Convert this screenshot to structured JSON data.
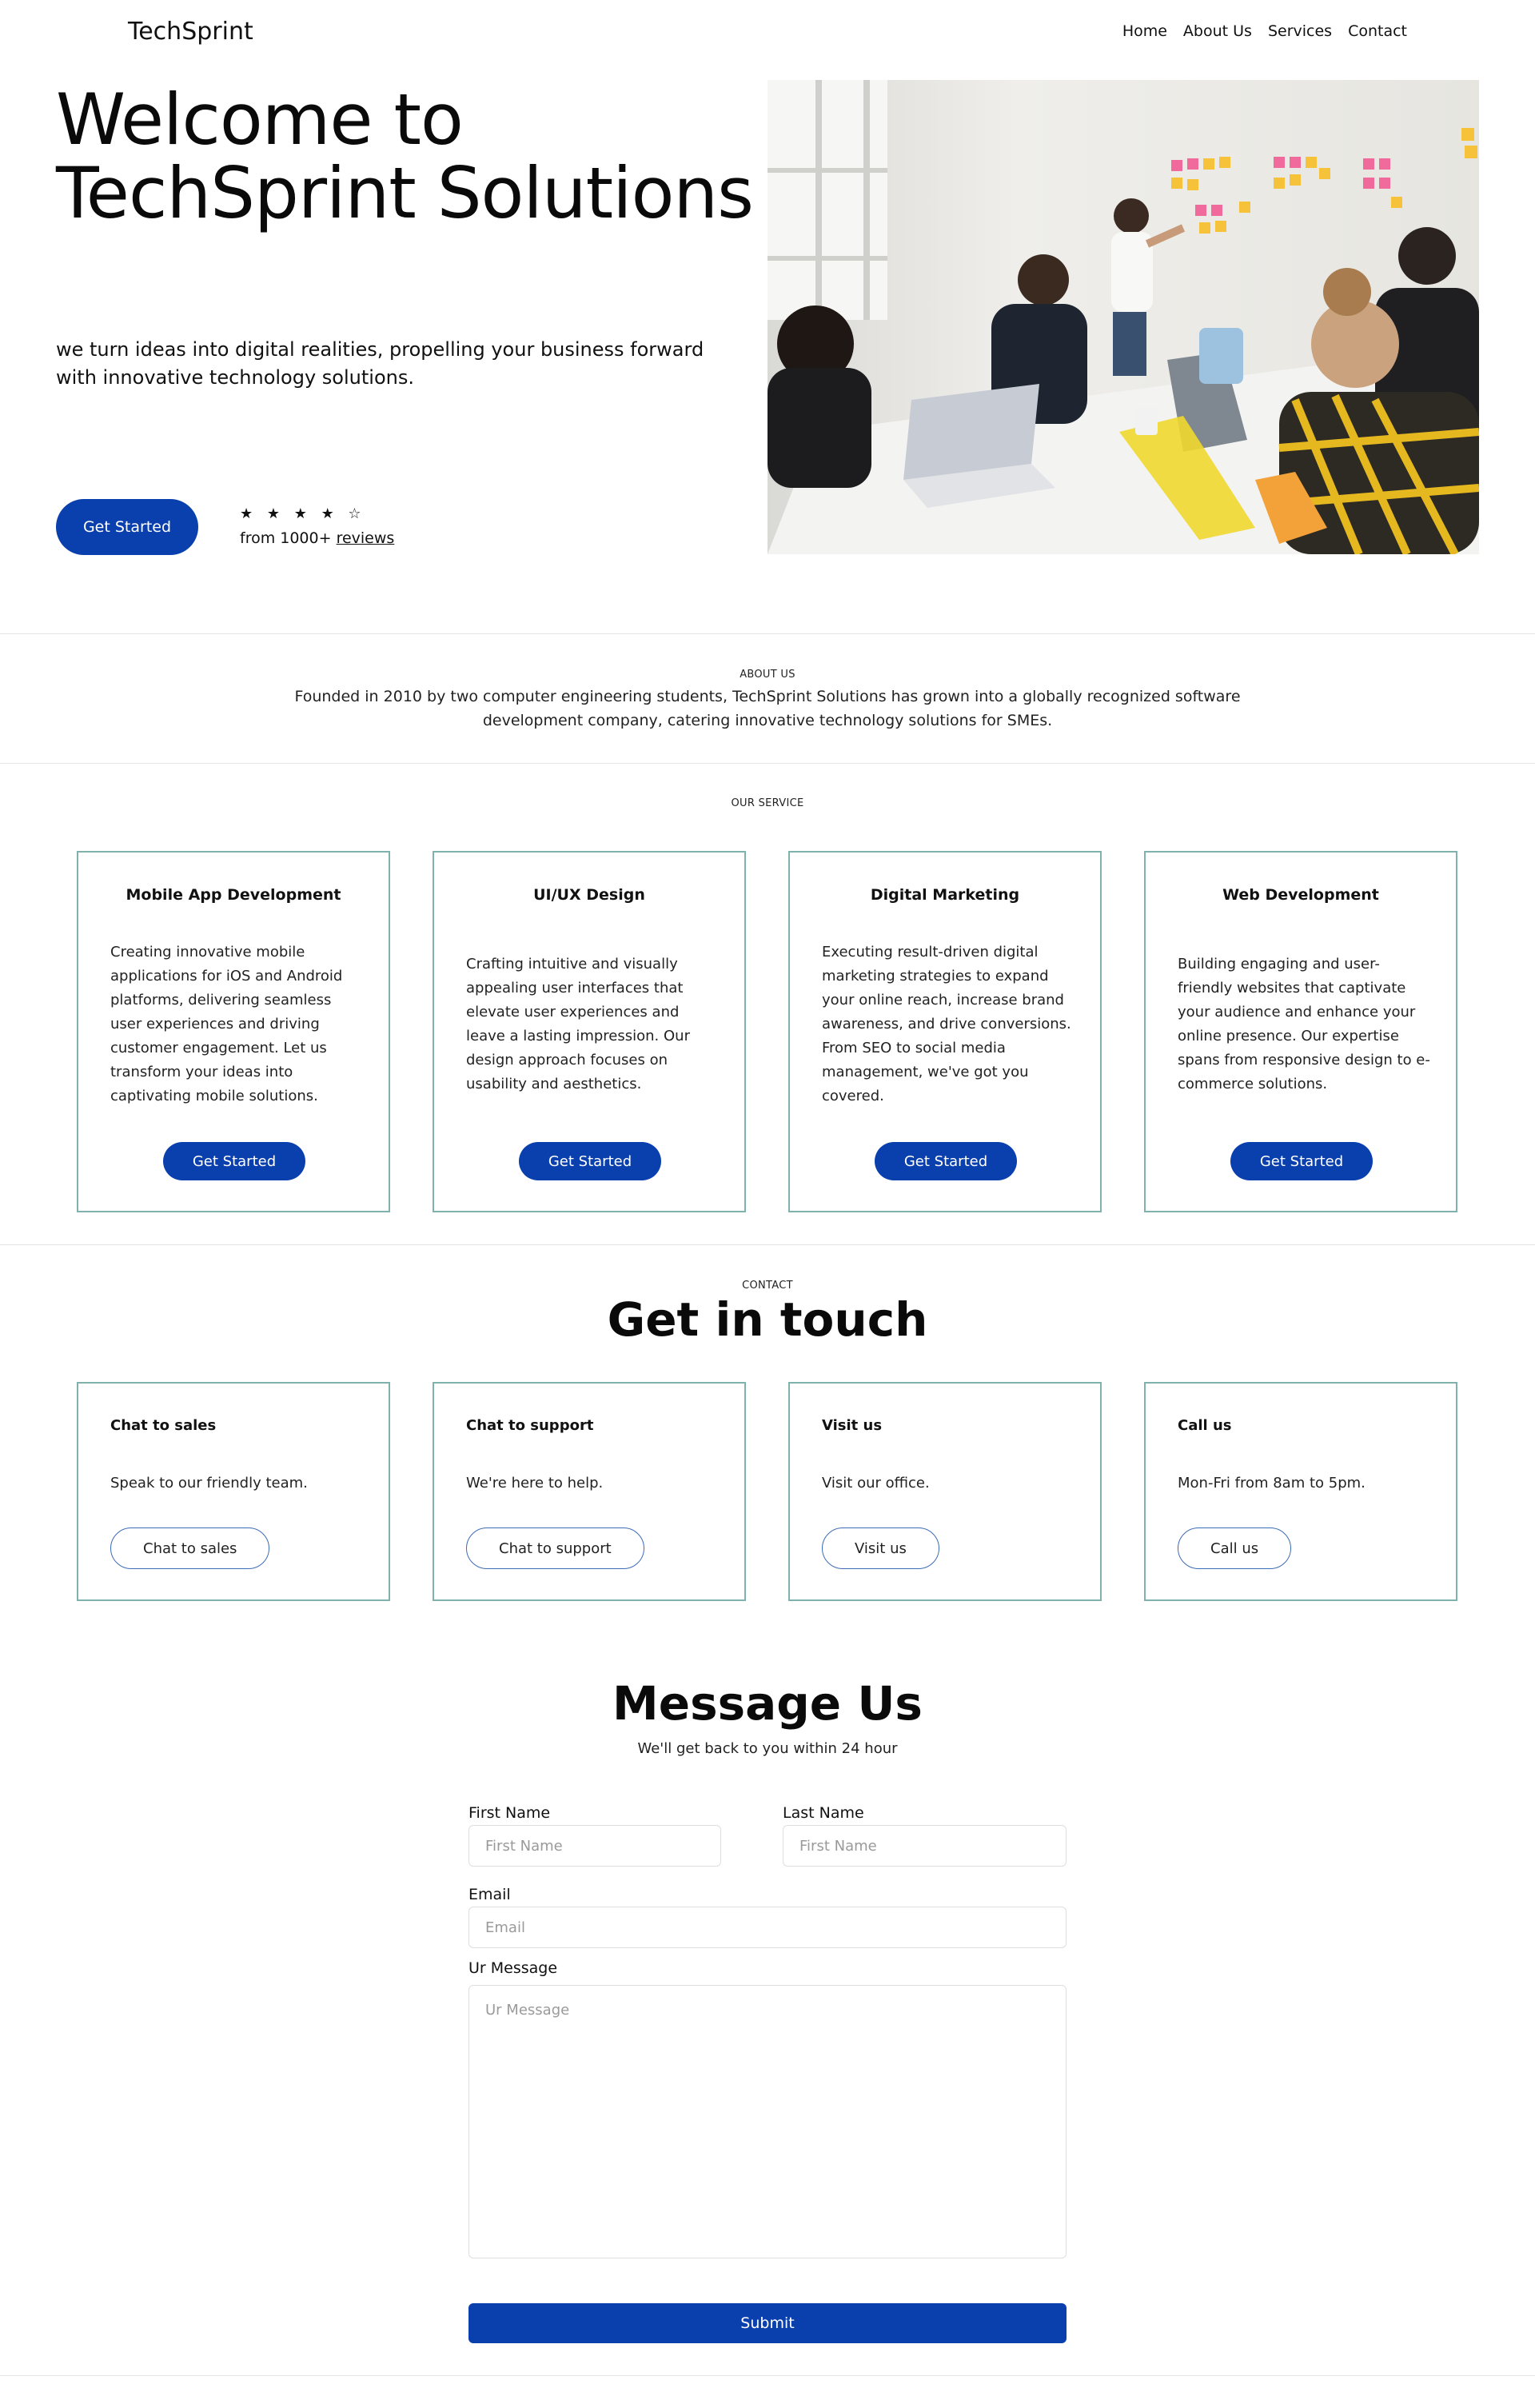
{
  "header": {
    "brand": "TechSprint",
    "nav": [
      "Home",
      "About Us",
      "Services",
      "Contact"
    ]
  },
  "hero": {
    "title": "Welcome to TechSprint Solutions",
    "subtitle": "we turn ideas into digital realities, propelling your business forward with innovative technology solutions.",
    "cta": "Get Started",
    "stars": "★ ★ ★ ★ ☆",
    "rating_prefix": "from 1000+ ",
    "rating_link": "reviews"
  },
  "about": {
    "eyebrow": "ABOUT US",
    "text": "Founded in 2010 by two computer engineering students, TechSprint Solutions has grown into a globally recognized software development company, catering innovative technology solutions for SMEs."
  },
  "services": {
    "eyebrow": "OUR SERVICE",
    "cards": [
      {
        "title": "Mobile App Development",
        "desc": "Creating innovative mobile applications for iOS and Android platforms, delivering seamless user experiences and driving customer engagement. Let us transform your ideas into captivating mobile solutions.",
        "button": "Get Started"
      },
      {
        "title": "UI/UX Design",
        "desc": "Crafting intuitive and visually appealing user interfaces that elevate user experiences and leave a lasting impression. Our design approach focuses on usability and aesthetics.",
        "button": "Get Started"
      },
      {
        "title": "Digital Marketing",
        "desc": "Executing result-driven digital marketing strategies to expand your online reach, increase brand awareness, and drive conversions. From SEO to social media management, we've got you covered.",
        "button": "Get Started"
      },
      {
        "title": "Web Development",
        "desc": "Building engaging and user-friendly websites that captivate your audience and enhance your online presence. Our expertise spans from responsive design to e-commerce solutions.",
        "button": "Get Started"
      }
    ]
  },
  "contact": {
    "eyebrow": "CONTACT",
    "title": "Get in touch",
    "cards": [
      {
        "title": "Chat to sales",
        "desc": "Speak to our friendly team.",
        "button": "Chat to sales"
      },
      {
        "title": "Chat to support",
        "desc": "We're here to help.",
        "button": "Chat to support"
      },
      {
        "title": "Visit us",
        "desc": "Visit our office.",
        "button": "Visit us"
      },
      {
        "title": "Call us",
        "desc": "Mon-Fri from 8am to 5pm.",
        "button": "Call us"
      }
    ]
  },
  "message": {
    "title": "Message Us",
    "subtitle": "We'll get back to you within 24 hour",
    "first_name_label": "First Name",
    "first_name_placeholder": "First Name",
    "last_name_label": "Last Name",
    "last_name_placeholder": "First Name",
    "email_label": "Email",
    "email_placeholder": "Email",
    "message_label": "Ur Message",
    "message_placeholder": "Ur Message",
    "submit": "Submit"
  },
  "colors": {
    "primary": "#0a3fae",
    "card_border": "#7fb2ac",
    "outline_button": "#3d6bb5"
  }
}
